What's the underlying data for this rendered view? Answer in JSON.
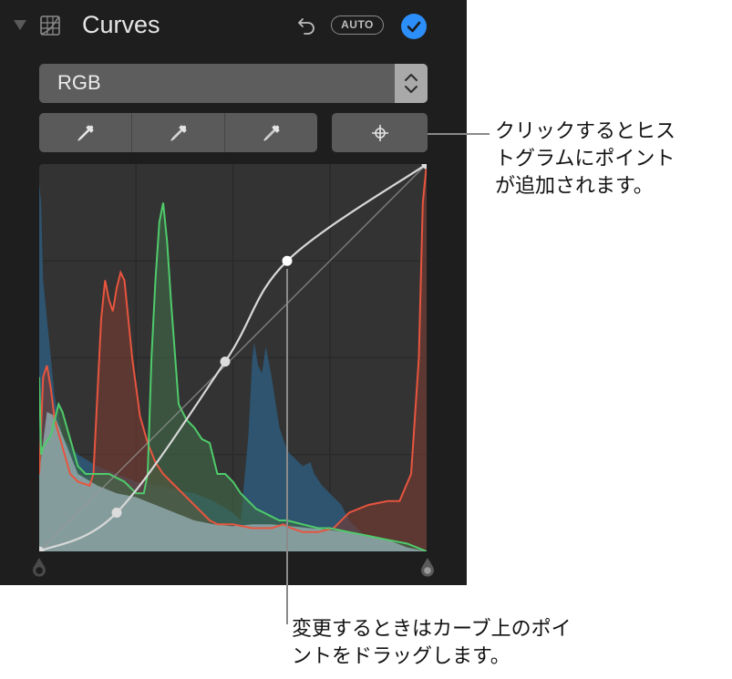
{
  "panel": {
    "title": "Curves",
    "auto_label": "AUTO",
    "channel_select": {
      "value": "RGB"
    },
    "eyedroppers": [
      {
        "name": "black-point-eyedropper"
      },
      {
        "name": "gray-point-eyedropper"
      },
      {
        "name": "white-point-eyedropper"
      }
    ],
    "add_point_tool": "target-crosshair",
    "colors": {
      "accent": "#2c8ef8",
      "red": "#e8553f",
      "green": "#4fcb6b",
      "blue": "#2e5a7a",
      "luminance": "#8fa8ab"
    }
  },
  "histogram": {
    "curve_points": [
      [
        0,
        0
      ],
      [
        0.2,
        0.1
      ],
      [
        0.48,
        0.49
      ],
      [
        0.64,
        0.75
      ],
      [
        1,
        1
      ]
    ],
    "channels": {
      "blue": [
        [
          0,
          0.95
        ],
        [
          0.005,
          0.9
        ],
        [
          0.01,
          0.7
        ],
        [
          0.02,
          0.6
        ],
        [
          0.03,
          0.5
        ],
        [
          0.04,
          0.4
        ],
        [
          0.05,
          0.35
        ],
        [
          0.06,
          0.3
        ],
        [
          0.08,
          0.27
        ],
        [
          0.1,
          0.25
        ],
        [
          0.15,
          0.22
        ],
        [
          0.2,
          0.2
        ],
        [
          0.25,
          0.18
        ],
        [
          0.3,
          0.17
        ],
        [
          0.35,
          0.16
        ],
        [
          0.4,
          0.15
        ],
        [
          0.45,
          0.13
        ],
        [
          0.5,
          0.1
        ],
        [
          0.52,
          0.08
        ],
        [
          0.54,
          0.3
        ],
        [
          0.55,
          0.5
        ],
        [
          0.555,
          0.54
        ],
        [
          0.565,
          0.48
        ],
        [
          0.575,
          0.46
        ],
        [
          0.585,
          0.53
        ],
        [
          0.6,
          0.45
        ],
        [
          0.62,
          0.32
        ],
        [
          0.64,
          0.26
        ],
        [
          0.66,
          0.24
        ],
        [
          0.68,
          0.22
        ],
        [
          0.7,
          0.23
        ],
        [
          0.71,
          0.2
        ],
        [
          0.73,
          0.17
        ],
        [
          0.75,
          0.15
        ],
        [
          0.78,
          0.12
        ],
        [
          0.8,
          0.08
        ],
        [
          0.83,
          0.05
        ],
        [
          0.86,
          0.03
        ],
        [
          0.9,
          0.02
        ],
        [
          0.93,
          0.02
        ],
        [
          0.96,
          0.01
        ],
        [
          1,
          0
        ]
      ],
      "red": [
        [
          0,
          0.2
        ],
        [
          0.01,
          0.45
        ],
        [
          0.02,
          0.48
        ],
        [
          0.03,
          0.42
        ],
        [
          0.04,
          0.34
        ],
        [
          0.06,
          0.27
        ],
        [
          0.08,
          0.2
        ],
        [
          0.1,
          0.18
        ],
        [
          0.13,
          0.17
        ],
        [
          0.14,
          0.2
        ],
        [
          0.16,
          0.6
        ],
        [
          0.17,
          0.7
        ],
        [
          0.18,
          0.65
        ],
        [
          0.19,
          0.62
        ],
        [
          0.2,
          0.68
        ],
        [
          0.21,
          0.72
        ],
        [
          0.22,
          0.7
        ],
        [
          0.24,
          0.5
        ],
        [
          0.26,
          0.35
        ],
        [
          0.28,
          0.28
        ],
        [
          0.3,
          0.23
        ],
        [
          0.32,
          0.2
        ],
        [
          0.34,
          0.18
        ],
        [
          0.36,
          0.16
        ],
        [
          0.4,
          0.12
        ],
        [
          0.42,
          0.1
        ],
        [
          0.44,
          0.08
        ],
        [
          0.46,
          0.07
        ],
        [
          0.5,
          0.07
        ],
        [
          0.55,
          0.06
        ],
        [
          0.6,
          0.06
        ],
        [
          0.63,
          0.07
        ],
        [
          0.65,
          0.06
        ],
        [
          0.68,
          0.05
        ],
        [
          0.72,
          0.05
        ],
        [
          0.76,
          0.06
        ],
        [
          0.8,
          0.1
        ],
        [
          0.85,
          0.12
        ],
        [
          0.9,
          0.13
        ],
        [
          0.93,
          0.13
        ],
        [
          0.96,
          0.2
        ],
        [
          0.98,
          0.5
        ],
        [
          0.99,
          0.9
        ],
        [
          1,
          1.0
        ]
      ],
      "green": [
        [
          0,
          0.45
        ],
        [
          0.005,
          0.25
        ],
        [
          0.01,
          0.27
        ],
        [
          0.03,
          0.3
        ],
        [
          0.05,
          0.38
        ],
        [
          0.06,
          0.36
        ],
        [
          0.08,
          0.29
        ],
        [
          0.1,
          0.22
        ],
        [
          0.12,
          0.2
        ],
        [
          0.15,
          0.2
        ],
        [
          0.18,
          0.2
        ],
        [
          0.2,
          0.19
        ],
        [
          0.22,
          0.18
        ],
        [
          0.25,
          0.15
        ],
        [
          0.27,
          0.15
        ],
        [
          0.28,
          0.2
        ],
        [
          0.29,
          0.5
        ],
        [
          0.3,
          0.7
        ],
        [
          0.31,
          0.85
        ],
        [
          0.32,
          0.9
        ],
        [
          0.33,
          0.8
        ],
        [
          0.34,
          0.65
        ],
        [
          0.36,
          0.38
        ],
        [
          0.38,
          0.34
        ],
        [
          0.4,
          0.32
        ],
        [
          0.42,
          0.29
        ],
        [
          0.44,
          0.28
        ],
        [
          0.46,
          0.2
        ],
        [
          0.48,
          0.2
        ],
        [
          0.5,
          0.18
        ],
        [
          0.52,
          0.15
        ],
        [
          0.54,
          0.13
        ],
        [
          0.56,
          0.11
        ],
        [
          0.58,
          0.1
        ],
        [
          0.6,
          0.09
        ],
        [
          0.62,
          0.08
        ],
        [
          0.64,
          0.08
        ],
        [
          0.68,
          0.07
        ],
        [
          0.72,
          0.06
        ],
        [
          0.75,
          0.06
        ],
        [
          0.8,
          0.05
        ],
        [
          0.85,
          0.04
        ],
        [
          0.9,
          0.03
        ],
        [
          0.95,
          0.02
        ],
        [
          1,
          0
        ]
      ],
      "luminance": [
        [
          0,
          0.2
        ],
        [
          0.02,
          0.36
        ],
        [
          0.04,
          0.35
        ],
        [
          0.06,
          0.3
        ],
        [
          0.08,
          0.25
        ],
        [
          0.1,
          0.2
        ],
        [
          0.15,
          0.17
        ],
        [
          0.2,
          0.15
        ],
        [
          0.25,
          0.14
        ],
        [
          0.3,
          0.12
        ],
        [
          0.35,
          0.1
        ],
        [
          0.4,
          0.08
        ],
        [
          0.45,
          0.07
        ],
        [
          0.5,
          0.065
        ],
        [
          0.55,
          0.07
        ],
        [
          0.6,
          0.07
        ],
        [
          0.65,
          0.065
        ],
        [
          0.7,
          0.06
        ],
        [
          0.75,
          0.055
        ],
        [
          0.8,
          0.05
        ],
        [
          0.85,
          0.04
        ],
        [
          0.9,
          0.03
        ],
        [
          0.95,
          0.01
        ],
        [
          1,
          0
        ]
      ]
    }
  },
  "callouts": {
    "add_point": "クリックするとヒス\nトグラムにポイント\nが追加されます。",
    "drag_point": "変更するときはカーブ上のポイ\nントをドラッグします。"
  }
}
